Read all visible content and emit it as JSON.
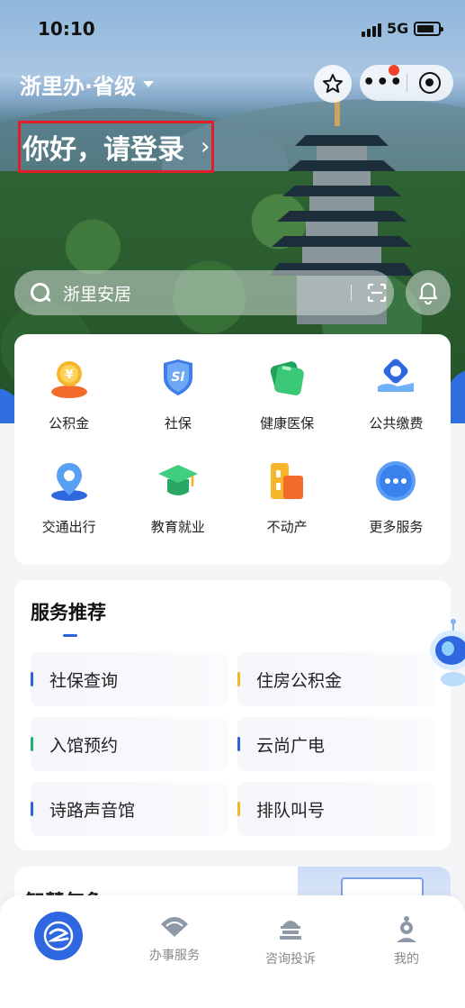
{
  "status_bar": {
    "time": "10:10",
    "network": "5G"
  },
  "header": {
    "region": "浙里办·省级",
    "login_prompt": "你好，请登录",
    "login_chevron": "›"
  },
  "search": {
    "placeholder": "浙里安居"
  },
  "services": [
    {
      "label": "公积金",
      "icon": "housing-fund-icon"
    },
    {
      "label": "社保",
      "icon": "social-security-icon"
    },
    {
      "label": "健康医保",
      "icon": "health-insurance-icon"
    },
    {
      "label": "公共缴费",
      "icon": "public-payment-icon"
    },
    {
      "label": "交通出行",
      "icon": "transport-icon"
    },
    {
      "label": "教育就业",
      "icon": "education-icon"
    },
    {
      "label": "不动产",
      "icon": "real-estate-icon"
    },
    {
      "label": "更多服务",
      "icon": "more-services-icon"
    }
  ],
  "recommend": {
    "title": "服务推荐",
    "items": [
      {
        "label": "社保查询",
        "accent": "#2c63d8"
      },
      {
        "label": "住房公积金",
        "accent": "#f2b51d"
      },
      {
        "label": "入馆预约",
        "accent": "#21b07a"
      },
      {
        "label": "云尚广电",
        "accent": "#2c63d8"
      },
      {
        "label": "诗路声音馆",
        "accent": "#2c63d8"
      },
      {
        "label": "排队叫号",
        "accent": "#f2b51d"
      }
    ]
  },
  "next_section": {
    "title": "智慧气象"
  },
  "tabbar": {
    "tabs": [
      {
        "label": "",
        "icon": "home-logo-icon"
      },
      {
        "label": "办事服务",
        "icon": "fan-icon"
      },
      {
        "label": "咨询投诉",
        "icon": "hall-icon"
      },
      {
        "label": "我的",
        "icon": "person-icon"
      }
    ]
  },
  "colors": {
    "primary": "#2e67e0",
    "login_highlight": "#e11d2a",
    "notify_dot": "#f0412b"
  }
}
